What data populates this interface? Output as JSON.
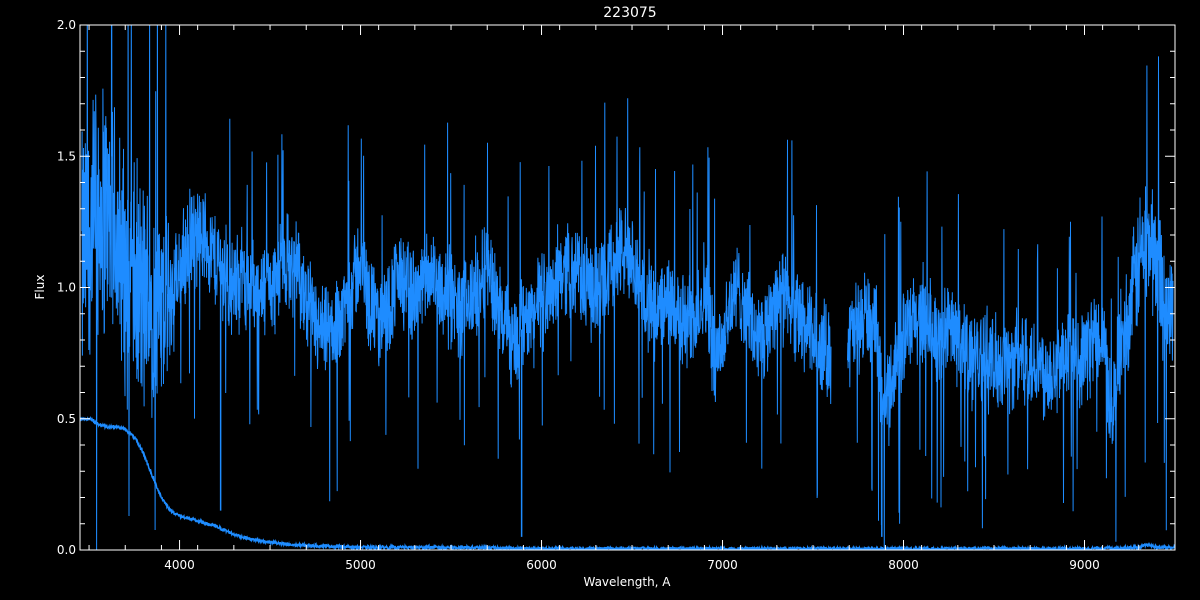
{
  "chart_data": {
    "type": "line",
    "title": "223075",
    "xlabel": "Wavelength, A",
    "ylabel": "Flux",
    "xlim": [
      3450,
      9500
    ],
    "ylim": [
      0,
      2.0
    ],
    "x_ticks": [
      4000,
      5000,
      6000,
      7000,
      8000,
      9000
    ],
    "x_tick_labels": [
      "4000",
      "5000",
      "6000",
      "7000",
      "8000",
      "9000"
    ],
    "y_ticks": [
      0,
      0.5,
      1.0,
      1.5,
      2.0
    ],
    "y_tick_labels": [
      "0.0",
      "0.5",
      "1.0",
      "1.5",
      "2.0"
    ],
    "grid": false,
    "colors": {
      "background": "#000000",
      "axes": "#ffffff",
      "series": "#1e8cff"
    },
    "series": [
      {
        "role": "flux",
        "x": [
          3460,
          3520,
          3580,
          3650,
          3700,
          3750,
          3800,
          3850,
          3900,
          3950,
          4000,
          4050,
          4100,
          4150,
          4200,
          4250,
          4300,
          4350,
          4400,
          4450,
          4500,
          4550,
          4600,
          4650,
          4700,
          4750,
          4800,
          4850,
          4900,
          4950,
          5000,
          5050,
          5100,
          5150,
          5200,
          5250,
          5300,
          5350,
          5400,
          5450,
          5500,
          5550,
          5600,
          5650,
          5700,
          5750,
          5800,
          5850,
          5900,
          5950,
          6000,
          6050,
          6100,
          6150,
          6200,
          6250,
          6300,
          6350,
          6400,
          6450,
          6500,
          6550,
          6600,
          6650,
          6700,
          6750,
          6800,
          6850,
          6900,
          6950,
          7000,
          7050,
          7100,
          7150,
          7200,
          7250,
          7300,
          7350,
          7400,
          7450,
          7500,
          7550,
          7600,
          7700,
          7750,
          7800,
          7850,
          7900,
          7950,
          8000,
          8050,
          8100,
          8150,
          8200,
          8250,
          8300,
          8350,
          8400,
          8450,
          8500,
          8550,
          8600,
          8650,
          8700,
          8750,
          8800,
          8850,
          8900,
          8950,
          9000,
          9050,
          9100,
          9150,
          9200,
          9250,
          9300,
          9350,
          9400,
          9450,
          9490
        ],
        "y": [
          1.1,
          1.25,
          1.3,
          1.2,
          1.05,
          1.0,
          0.95,
          0.95,
          0.9,
          0.95,
          1.05,
          1.15,
          1.2,
          1.18,
          1.1,
          1.05,
          1.0,
          1.05,
          1.0,
          0.98,
          1.0,
          1.05,
          1.1,
          1.05,
          0.95,
          0.85,
          0.8,
          0.85,
          0.9,
          1.0,
          1.1,
          0.95,
          0.85,
          0.9,
          1.05,
          1.0,
          0.95,
          1.0,
          1.05,
          1.0,
          0.95,
          0.9,
          0.95,
          1.0,
          1.1,
          0.95,
          0.85,
          0.8,
          0.85,
          0.9,
          0.95,
          1.0,
          1.05,
          1.1,
          1.05,
          1.0,
          1.0,
          1.05,
          1.1,
          1.15,
          1.05,
          1.0,
          0.95,
          0.9,
          0.95,
          0.9,
          0.85,
          0.9,
          1.0,
          0.75,
          0.8,
          0.95,
          1.0,
          0.85,
          0.8,
          0.85,
          1.0,
          0.95,
          0.9,
          0.85,
          0.8,
          0.78,
          0.75,
          0.8,
          0.85,
          0.9,
          0.8,
          0.55,
          0.7,
          0.8,
          0.85,
          0.9,
          0.85,
          0.8,
          0.85,
          0.8,
          0.75,
          0.7,
          0.75,
          0.7,
          0.72,
          0.7,
          0.75,
          0.72,
          0.7,
          0.68,
          0.7,
          0.72,
          0.7,
          0.75,
          0.8,
          0.85,
          0.5,
          0.8,
          0.9,
          1.1,
          1.2,
          1.1,
          0.95,
          0.9
        ],
        "noise_amplitude": [
          0.6,
          0.6,
          0.6,
          0.55,
          0.55,
          0.55,
          0.55,
          0.5,
          0.45,
          0.35,
          0.25,
          0.25,
          0.22,
          0.22,
          0.22,
          0.22,
          0.22,
          0.22,
          0.22,
          0.22,
          0.22,
          0.22,
          0.22,
          0.22,
          0.22,
          0.22,
          0.22,
          0.22,
          0.22,
          0.22,
          0.22,
          0.22,
          0.22,
          0.22,
          0.22,
          0.22,
          0.22,
          0.22,
          0.22,
          0.22,
          0.22,
          0.22,
          0.22,
          0.22,
          0.22,
          0.22,
          0.22,
          0.22,
          0.22,
          0.22,
          0.22,
          0.22,
          0.22,
          0.22,
          0.22,
          0.22,
          0.22,
          0.22,
          0.22,
          0.22,
          0.22,
          0.22,
          0.22,
          0.22,
          0.22,
          0.22,
          0.22,
          0.22,
          0.22,
          0.22,
          0.22,
          0.22,
          0.22,
          0.22,
          0.22,
          0.22,
          0.22,
          0.22,
          0.22,
          0.22,
          0.22,
          0.22,
          0.22,
          0.22,
          0.22,
          0.22,
          0.22,
          0.22,
          0.22,
          0.22,
          0.22,
          0.22,
          0.22,
          0.22,
          0.22,
          0.22,
          0.22,
          0.22,
          0.22,
          0.22,
          0.22,
          0.22,
          0.22,
          0.22,
          0.22,
          0.22,
          0.22,
          0.22,
          0.22,
          0.22,
          0.22,
          0.22,
          0.22,
          0.22,
          0.25,
          0.3,
          0.3,
          0.3,
          0.3,
          0.3
        ],
        "gaps": [
          [
            7600,
            7690
          ]
        ],
        "absorption_lines": [
          {
            "x": 4227,
            "y": 0.15
          },
          {
            "x": 5890,
            "y": 0.05
          },
          {
            "x": 7880,
            "y": 0.05
          }
        ]
      },
      {
        "role": "error",
        "x": [
          3450,
          3500,
          3550,
          3600,
          3650,
          3700,
          3750,
          3800,
          3850,
          3900,
          3950,
          4000,
          4100,
          4200,
          4300,
          4400,
          4500,
          4600,
          4800,
          5000,
          5500,
          6000,
          7000,
          8000,
          9000,
          9300,
          9350,
          9400,
          9500
        ],
        "y": [
          0.5,
          0.5,
          0.48,
          0.47,
          0.47,
          0.46,
          0.43,
          0.37,
          0.28,
          0.2,
          0.15,
          0.13,
          0.11,
          0.09,
          0.06,
          0.04,
          0.03,
          0.02,
          0.015,
          0.01,
          0.01,
          0.005,
          0.005,
          0.005,
          0.005,
          0.01,
          0.02,
          0.01,
          0.01
        ]
      }
    ]
  }
}
